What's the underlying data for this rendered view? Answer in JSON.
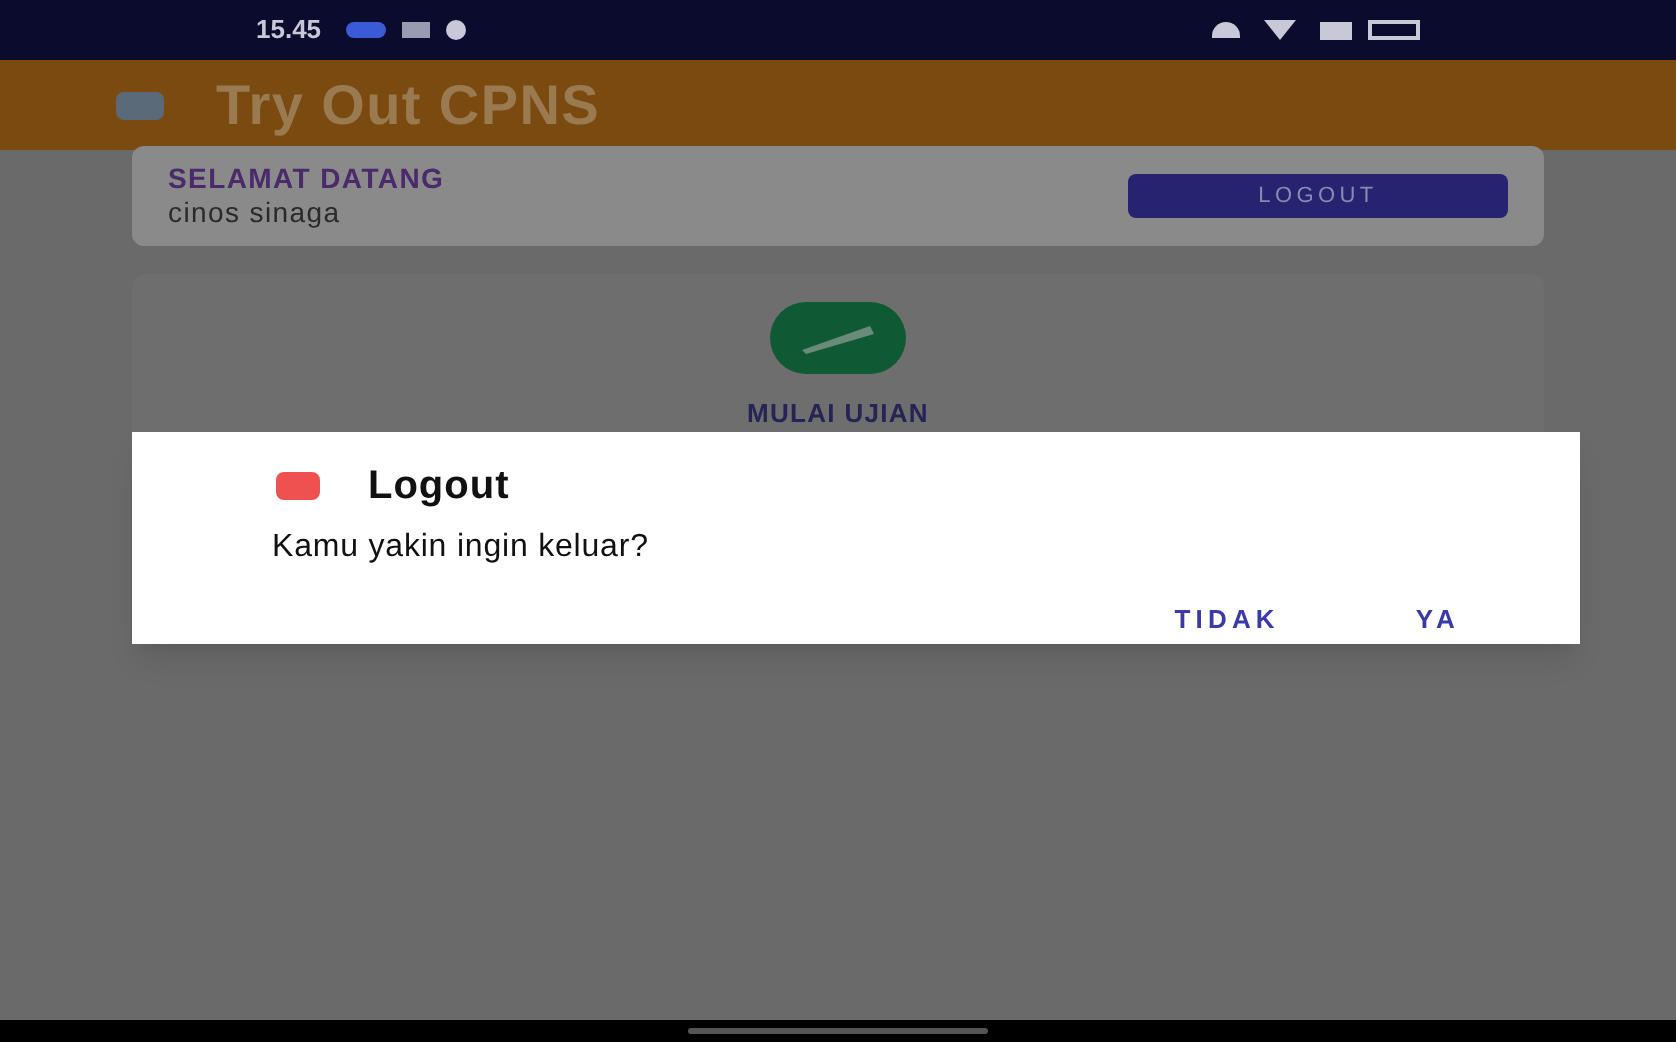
{
  "status_bar": {
    "time": "15.45"
  },
  "app_bar": {
    "title": "Try Out CPNS"
  },
  "welcome_card": {
    "heading": "SELAMAT DATANG",
    "user_name": "cinos sinaga",
    "logout_button": "LOGOUT"
  },
  "menu_card": {
    "label": "MULAI UJIAN"
  },
  "dialog": {
    "title": "Logout",
    "message": "Kamu yakin ingin keluar?",
    "buttons": [
      "TIDAK",
      "YA"
    ]
  }
}
